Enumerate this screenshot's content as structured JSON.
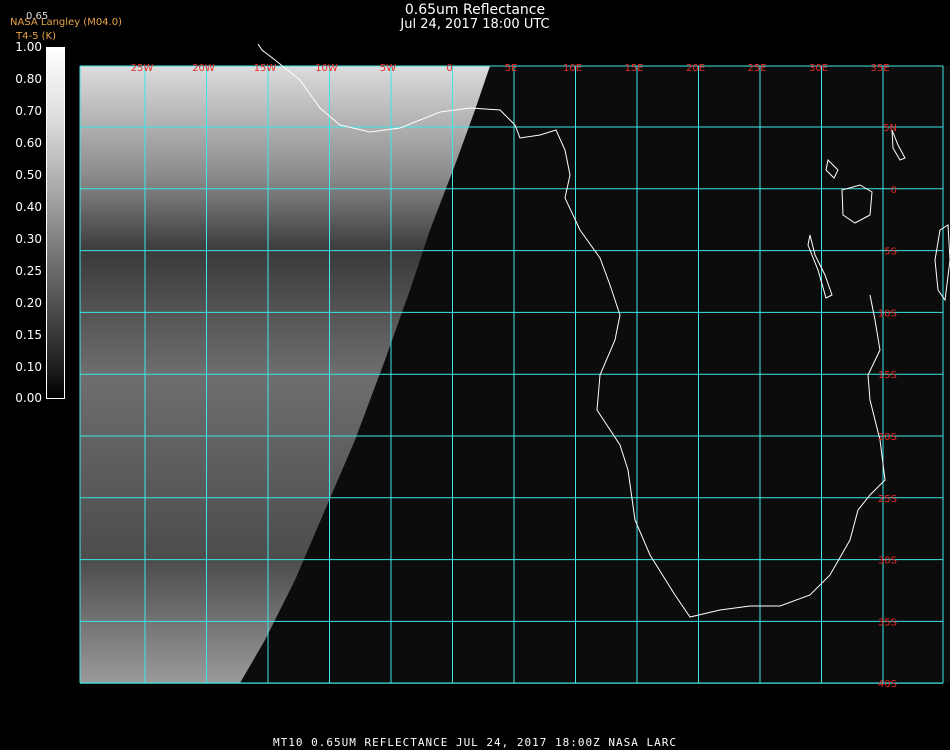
{
  "title": "0.65um Reflectance",
  "subtitle": "Jul 24, 2017 18:00 UTC",
  "credit_line1": "NASA Langley (M04.0)",
  "credit_line2": "T4-5 (K)",
  "scale_value": "0.65",
  "colorbar": {
    "labels": [
      "1.00",
      "0.80",
      "0.70",
      "0.60",
      "0.50",
      "0.40",
      "0.30",
      "0.25",
      "0.20",
      "0.15",
      "0.10",
      "0.00"
    ]
  },
  "map": {
    "lon_labels": [
      "25W",
      "20W",
      "15W",
      "10W",
      "5W",
      "0",
      "5E",
      "10E",
      "15E",
      "20E",
      "25E",
      "30E",
      "35E"
    ],
    "lat_labels": [
      "5N",
      "0",
      "5S",
      "10S",
      "15S",
      "20S",
      "25S",
      "30S",
      "35S",
      "40S"
    ],
    "grid_color": "#3ee6e6",
    "label_color": "#e82a2a",
    "coast_color": "#ffffff"
  },
  "footer": "MT10  0.65UM REFLECTANCE    JUL 24, 2017 18:00Z    NASA LARC"
}
